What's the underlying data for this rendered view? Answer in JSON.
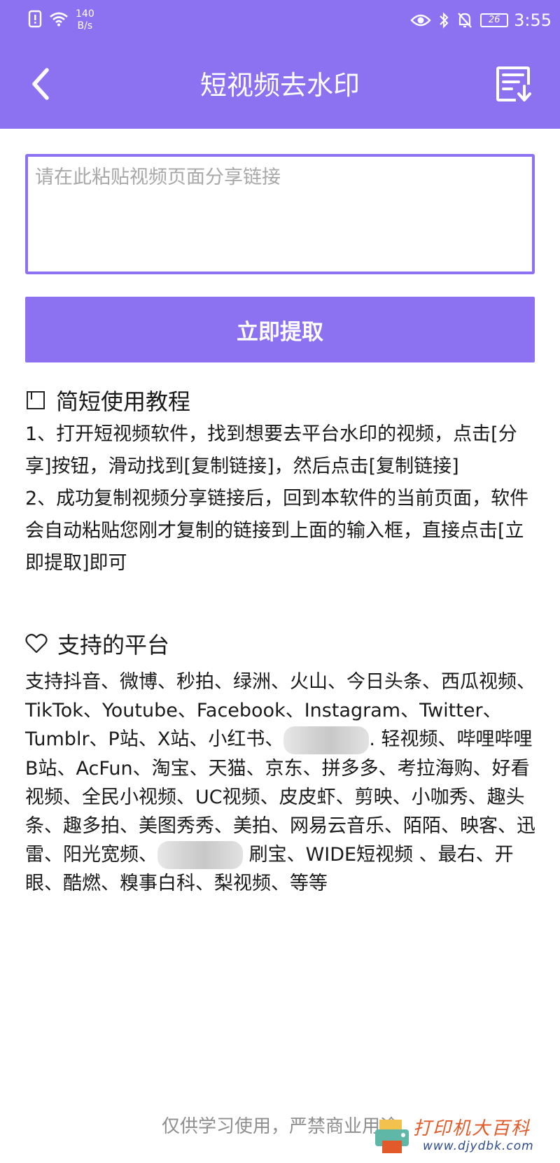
{
  "status_bar": {
    "net_speed_value": "140",
    "net_speed_unit": "B/s",
    "battery": "26",
    "time": "3:55"
  },
  "header": {
    "title": "短视频去水印",
    "back_icon": "chevron-left-icon",
    "history_icon": "download-list-icon"
  },
  "form": {
    "placeholder": "请在此粘贴视频页面分享链接",
    "value": "",
    "extract_button": "立即提取"
  },
  "tutorial": {
    "title": "简短使用教程",
    "steps": [
      "1、打开短视频软件，找到想要去平台水印的视频，点击[分享]按钮，滑动找到[复制链接]，然后点击[复制链接]",
      "2、成功复制视频分享链接后，回到本软件的当前页面，软件会自动粘贴您刚才复制的链接到上面的输入框，直接点击[立即提取]即可"
    ]
  },
  "platforms": {
    "title": "支持的平台",
    "text_before_first_blur": "支持抖音、微博、秒拍、绿洲、火山、今日头条、西瓜视频、TikTok、Youtube、Facebook、Instagram、Twitter、Tumblr、P站、X站、小红书、",
    "text_between_blurs": ". 轻视频、哔哩哔哩B站、AcFun、淘宝、天猫、京东、拼多多、考拉海购、好看视频、全民小视频、UC视频、皮皮虾、剪映、小咖秀、趣头条、趣多拍、美图秀秀、美拍、网易云音乐、陌陌、映客、迅雷、阳光宽频、",
    "text_after_second_blur": " 刷宝、WIDE短视频 、最右、开眼、酷燃、糗事白科、梨视频、等等"
  },
  "footer": {
    "note": "仅供学习使用，严禁商业用途"
  },
  "watermark": {
    "text": "打印机大百科",
    "url": "www.djydbk.com"
  },
  "colors": {
    "accent": "#8c71f0",
    "footer_text": "#8e8e8e",
    "placeholder": "#a8a8a8"
  }
}
